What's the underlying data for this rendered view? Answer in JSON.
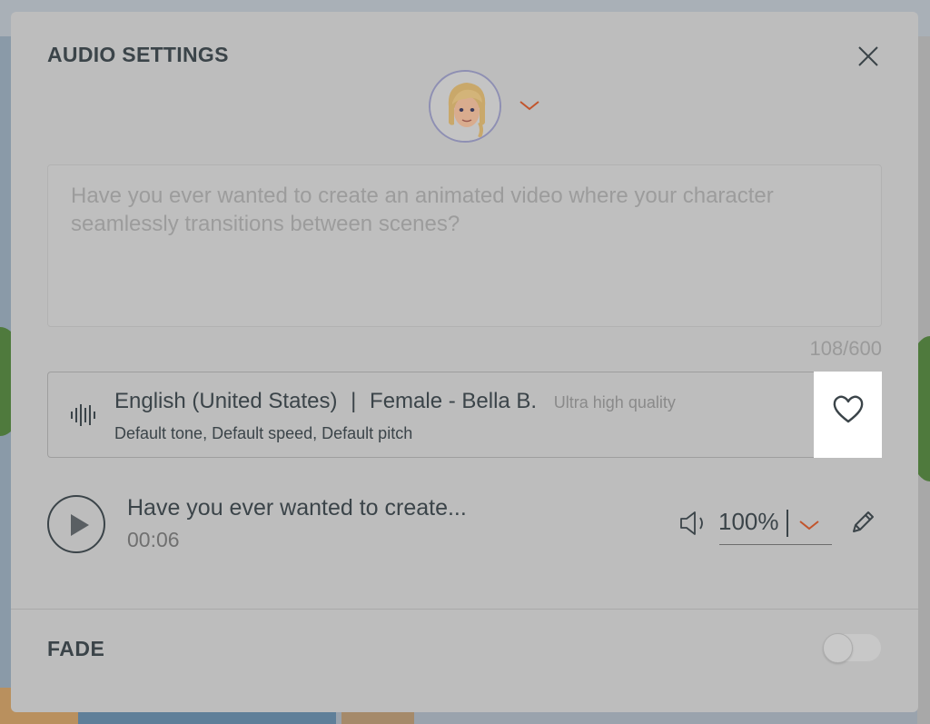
{
  "dialog": {
    "title": "AUDIO SETTINGS"
  },
  "script": {
    "text": "Have you ever wanted to create an animated video where your character seamlessly transitions between scenes?",
    "char_count": "108/600"
  },
  "voice": {
    "language": "English (United States)",
    "separator": "|",
    "name": "Female - Bella B.",
    "quality": "Ultra high quality",
    "settings": "Default tone, Default speed, Default pitch"
  },
  "clip": {
    "title": "Have you ever wanted to create...",
    "duration": "00:06"
  },
  "volume": {
    "value": "100%"
  },
  "fade": {
    "label": "FADE",
    "enabled": false
  },
  "colors": {
    "accent": "#c2552c",
    "text": "#3b4449",
    "overlay": "#bdbdbd"
  },
  "icons": [
    "close-icon",
    "chevron-down-icon",
    "waveform-icon",
    "heart-icon",
    "play-icon",
    "speaker-icon",
    "pencil-icon"
  ]
}
